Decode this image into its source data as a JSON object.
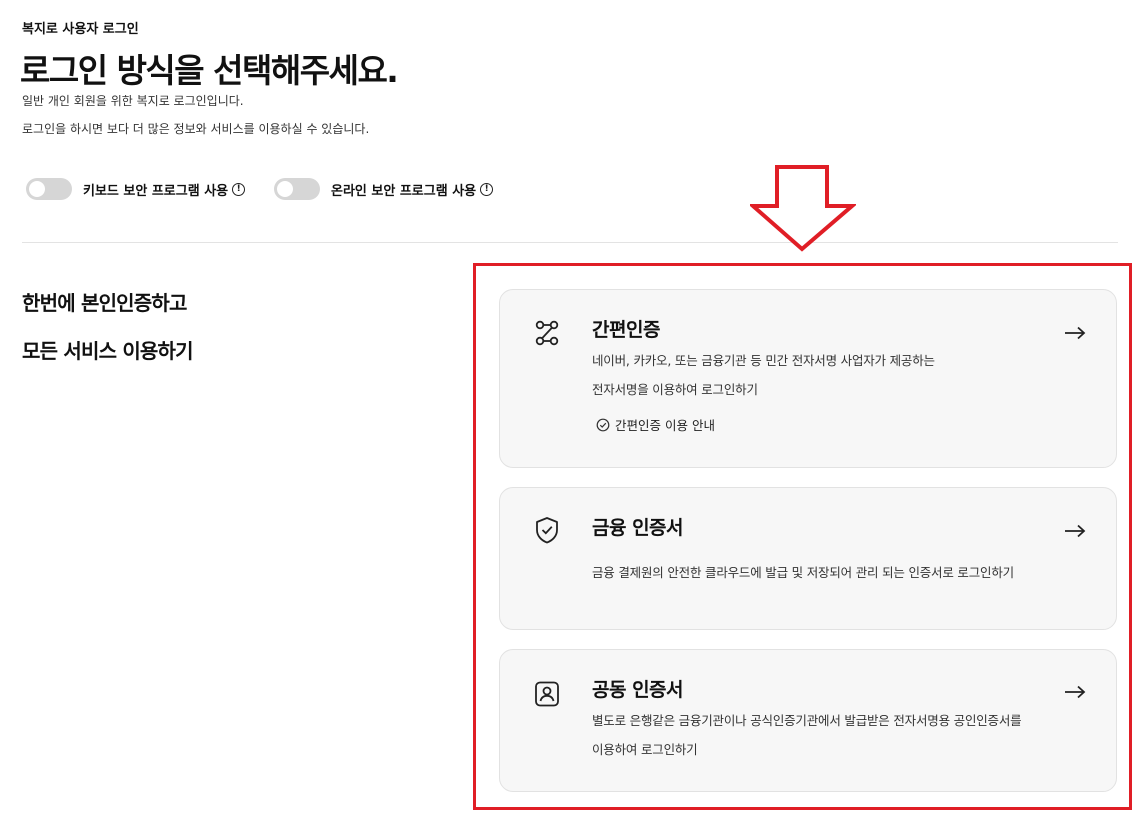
{
  "header": {
    "breadcrumb": "복지로 사용자 로그인",
    "title": "로그인 방식을 선택해주세요.",
    "desc_line1": "일반 개인 회원을 위한 복지로 로그인입니다.",
    "desc_line2": "로그인을 하시면 보다 더 많은 정보와 서비스를 이용하실 수 있습니다."
  },
  "toggles": [
    {
      "label": "키보드 보안 프로그램 사용",
      "on": false
    },
    {
      "label": "온라인 보안 프로그램 사용",
      "on": false
    }
  ],
  "side": {
    "line1": "한번에 본인인증하고",
    "line2": "모든 서비스 이용하기"
  },
  "options": [
    {
      "icon": "route-icon",
      "title": "간편인증",
      "desc_line1": "네이버, 카카오, 또는 금융기관 등 민간 전자서명 사업자가 제공하는",
      "desc_line2": "전자서명을 이용하여 로그인하기",
      "guide_label": "간편인증 이용 안내"
    },
    {
      "icon": "shield-check-icon",
      "title": "금융 인증서",
      "desc_line1": "금융 결제원의 안전한 클라우드에 발급 및 저장되어 관리 되는 인증서로 로그인하기"
    },
    {
      "icon": "id-card-icon",
      "title": "공동 인증서",
      "desc_line1": "별도로 은행같은 금융기관이나 공식인증기관에서 발급받은 전자서명용 공인인증서를",
      "desc_line2": "이용하여 로그인하기"
    }
  ],
  "colors": {
    "annotation": "#e01e26",
    "card_bg": "#f7f7f7",
    "toggle_off": "#d6d6d6"
  }
}
